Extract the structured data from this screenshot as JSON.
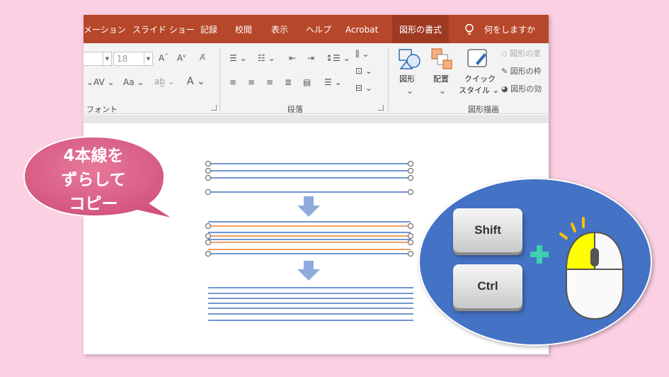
{
  "ribbon_tabs": [
    {
      "label": "メーション"
    },
    {
      "label": "スライド ショー"
    },
    {
      "label": "記録"
    },
    {
      "label": "校閲"
    },
    {
      "label": "表示"
    },
    {
      "label": "ヘルプ"
    },
    {
      "label": "Acrobat"
    },
    {
      "label": "図形の書式"
    }
  ],
  "tell_me": "何をしますか",
  "font_group": {
    "label": "フォント",
    "size_value": "18"
  },
  "paragraph_group": {
    "label": "段落"
  },
  "drawing_group": {
    "label": "図形描画",
    "shape_label": "図形",
    "arrange_label": "配置",
    "quick_style_label1": "クイック",
    "quick_style_label2": "スタイル",
    "menu_items": [
      "図形の塗",
      "図形の枠",
      "図形の効"
    ]
  },
  "callout": {
    "lines": [
      "4本線を",
      "ずらして",
      "コピー"
    ]
  },
  "keys": {
    "shift": "Shift",
    "ctrl": "Ctrl"
  },
  "colors": {
    "accent_red": "#b7472a",
    "line_blue": "#4472c4",
    "line_orange": "#ed7d31",
    "bubble_pink": "#d85b82",
    "circle_blue": "#4472c4",
    "plus_teal": "#3ecfb0",
    "mouse_yellow": "#ffff00"
  }
}
